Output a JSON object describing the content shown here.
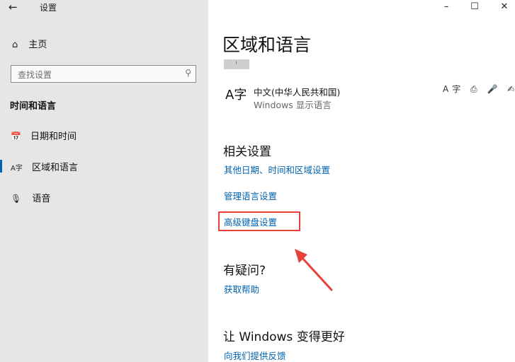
{
  "titlebar": {
    "back_glyph": "←",
    "app_title": "设置",
    "minimize_glyph": "–",
    "maximize_glyph": "☐",
    "close_glyph": "✕"
  },
  "sidebar": {
    "home": {
      "icon": "⌂",
      "label": "主页"
    },
    "search": {
      "placeholder": "查找设置",
      "icon": "⚲"
    },
    "section_title": "时间和语言",
    "items": [
      {
        "icon": "📅",
        "label": "日期和时间"
      },
      {
        "icon": "A字",
        "label": "区域和语言"
      },
      {
        "icon": "🎙",
        "label": "语音"
      }
    ]
  },
  "main": {
    "title": "区域和语言",
    "language": {
      "icon": "A字",
      "name": "中文(中华人民共和国)",
      "subtitle": "Windows 显示语言",
      "feature_icons": "A字 ⎙ 🎤 ✍"
    },
    "related": {
      "heading": "相关设置",
      "links": [
        "其他日期、时间和区域设置",
        "管理语言设置",
        "高级键盘设置"
      ]
    },
    "question": {
      "heading": "有疑问?",
      "link": "获取帮助"
    },
    "improve": {
      "heading": "让 Windows 变得更好",
      "link": "向我们提供反馈"
    }
  },
  "annotation": {
    "highlight_color": "#e8413a"
  },
  "colors": {
    "accent": "#0063b1",
    "sidebar_bg": "#e6e6e6"
  }
}
